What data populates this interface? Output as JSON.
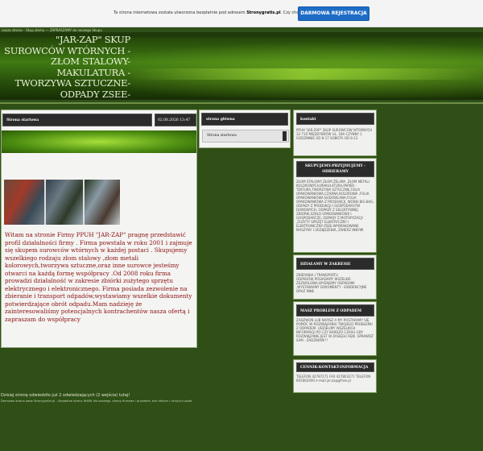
{
  "promo": {
    "text_before": "Ta strona internetowa została utworzona bezpłatnie pod adresem ",
    "site": "Stronygratis.pl",
    "text_after": ". Czy chcesz też mieć własną stronę?",
    "button": "DARMOWA REJESTRACJA"
  },
  "breadcrumb": "nasza strona – Skup złomu — ZAPRASZAMY do naszego Skupu",
  "header": {
    "title": "\"JAR-ZAP\" SKUP SUROWCÓW WTÓRNYCH - ZŁOM STALOWY- MAKULATURA - TWORZYWA SZTUCZNE- ODPADY ZSEE-"
  },
  "main": {
    "tab_label": "Strona startowa",
    "datetime": "02.08.2026 13:47",
    "paragraph": "Witam na stronie Firmy PPUH \"JAR-ZAP\" pragnę przedstawić profil działalności firmy . Firma powstała w roku 2001 i zajmuje się skupem surowców wtórnych  w każdej postaci . Skupujemy wszelkiego rodzaju złom stalowy ,złom metali kolorowych,tworzywa sztuczne,oraz inne surowce jesteśmy otwarci na każdą formę współpracy .Od 2008 roku firma prowadzi działalność w zakresie zbiórki zużytego sprzętu elektrycznego i elektronicznego. Firma posiada zezwolenie na zbieranie i transport odpadów,wystawiamy wszelkie dokumenty potwierdzające obrót odpadu.Mam nadzieję że zainteresowaliśmy potencjalnych kontrachentów nasza ofertą i zapraszam do współpracy"
  },
  "nav": {
    "title": "strona główna",
    "items": [
      "Strona startowa"
    ]
  },
  "sidebar": {
    "kontakt": {
      "title": "kontakt",
      "body": "PPUH \"JAR-ZAP\" SKUP SUROWCÓW WTÓRNYCH 32-710 MIĘDZYBRÓW UL. 18A CZYNNY 1 GODZINNIE OD 8-17 SOBOTA OD 8-13"
    },
    "skupujemy": {
      "title": "SKUPUJEMY-PRZYJMUJEMY - ODBIERAMY",
      "body": "ZŁOM STALOWY,ZŁOM ŻELIWA ,ZŁOM METALI KOLOROWYCH,MAKULATURA,PAPIER - TEKTURA,TWORZYWA SZTUCZNE,FOLIA OPAKOWANIOWA,CZARNA,KOLOROWA ,FOLIA OPAKOWANIOWA BUDOWLANA,FOLIA OPAKOWANIOWA Z PRODUKCJI, WORKI BIG-BAG, ODPADY Z PRODUKCJI I GOSPODARSTW DOMOWYCH, ODPADY Z SELEKTYWNEJ ZBIÓRKI,SZKŁO OPAKOWANIOWE I GOSPODARCZE, ODPADY Z MOTORYZACJI ,ZUŻYTY SPRZĘT ELEKTRYCZNY I ELEKTRONICZNY-ZSEE-WYBRAKOWANE MASZYNY I URZĄDZENIA, ZWIERZ INNYMI"
    },
    "dzialamy": {
      "title": "DZIAŁAMY W ZAKRESIE",
      "body": "ZBIERANIA I TRANSPORTU ODPADÓW,POSIADAMY WSZELKIE ZEZWOLENIA,WYDAJEMY ODPADAMI ,WYSTAWIAMY DOKUMENTY - EWIDENCYJNE ORAZ INNE"
    },
    "problem": {
      "title": "MASZ PROBLEM Z ODPADEM",
      "body": "ZADZWOŃ LUB NAPISZ A MY POSTARAMY SIĘ POMÓC W ROZWIĄZANIU TWOJEGO PROBLEMU Z ODPADEM. UDZIELIMY WSZELKICH INFORMACJI PO CZY BARDZO CZASU GDY ROZWIĄZANIE JEST W ZASIĘGU RĘKI. SPRAWDŹ SAM - ZADZWOŃ!!!"
    },
    "cennik": {
      "title": "CENNIK-KONTAKT-INFORMACJA",
      "body": "TELEFON 42787271 FAX 427803271 TELEFON 605662400 e-mail jar.zap@free.pl"
    }
  },
  "visits": "Dzisiaj stronę odwiedziło już 2 odwiedzających (2 wejścia) tutaj!",
  "footer": "Darmowa strona www Stronygratis.pl – Bezpłatne strony WWW dla każdego, strony firmowe i prywatne, bez reklam i ukrytych opłat"
}
